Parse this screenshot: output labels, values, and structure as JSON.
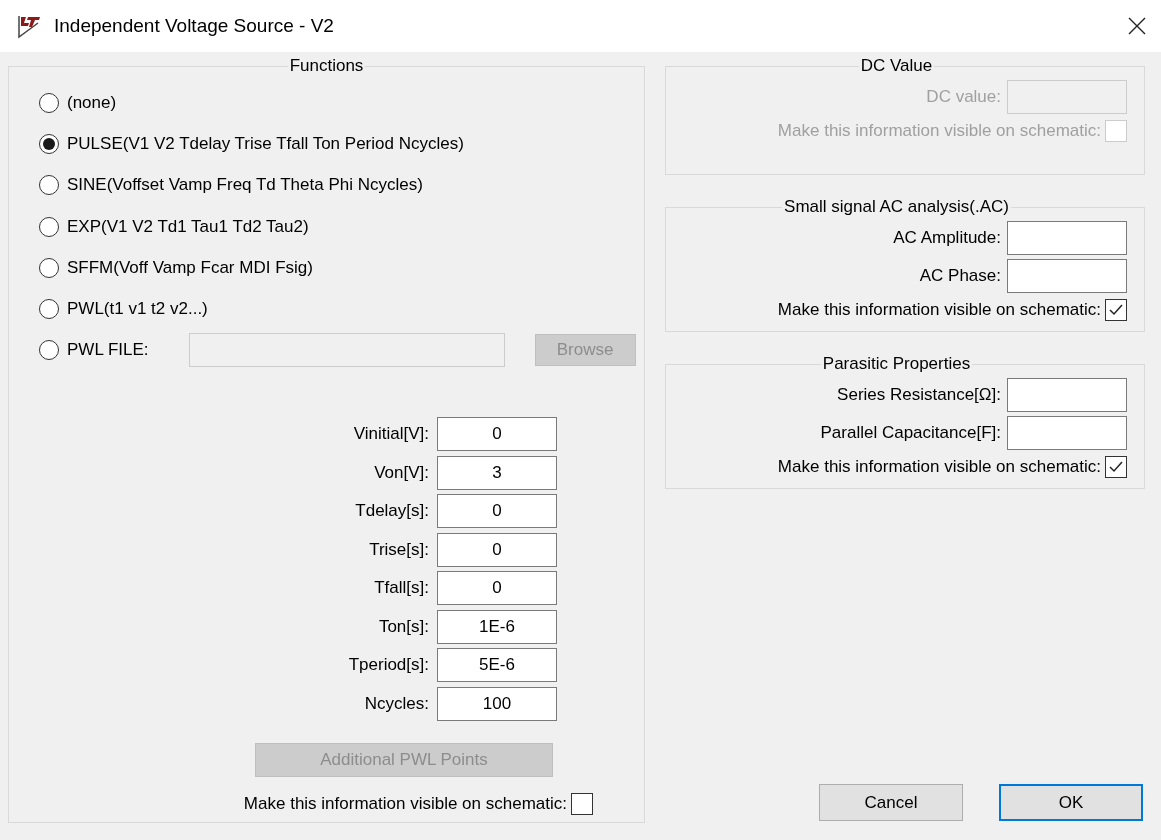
{
  "window": {
    "title": "Independent Voltage Source - V2"
  },
  "functions": {
    "legend": "Functions",
    "options": [
      {
        "label": "(none)",
        "selected": false
      },
      {
        "label": "PULSE(V1 V2 Tdelay Trise Tfall Ton Period Ncycles)",
        "selected": true
      },
      {
        "label": "SINE(Voffset Vamp Freq Td Theta Phi Ncycles)",
        "selected": false
      },
      {
        "label": "EXP(V1 V2 Td1 Tau1 Td2 Tau2)",
        "selected": false
      },
      {
        "label": "SFFM(Voff Vamp Fcar MDI Fsig)",
        "selected": false
      },
      {
        "label": "PWL(t1 v1 t2 v2...)",
        "selected": false
      },
      {
        "label": "PWL FILE:",
        "selected": false,
        "kind": "file"
      }
    ],
    "pwl_file": {
      "disabled": true,
      "browse": {
        "label": "Browse",
        "disabled": true
      }
    },
    "parameters": [
      {
        "label": "Vinitial[V]:",
        "value": "0"
      },
      {
        "label": "Von[V]:",
        "value": "3"
      },
      {
        "label": "Tdelay[s]:",
        "value": "0"
      },
      {
        "label": "Trise[s]:",
        "value": "0"
      },
      {
        "label": "Tfall[s]:",
        "value": "0"
      },
      {
        "label": "Ton[s]:",
        "value": "1E-6"
      },
      {
        "label": "Tperiod[s]:",
        "value": "5E-6"
      },
      {
        "label": "Ncycles:",
        "value": "100"
      }
    ],
    "additional_button": {
      "label": "Additional PWL Points",
      "disabled": true
    },
    "visible": {
      "label": "Make this information visible on schematic:",
      "checked": false
    }
  },
  "groups": [
    {
      "legend": "DC Value",
      "disabled": true,
      "fields": [
        {
          "label": "DC value:"
        }
      ],
      "visible": {
        "label": "Make this information visible on schematic:",
        "checked": false
      }
    },
    {
      "legend": "Small signal AC analysis(.AC)",
      "disabled": false,
      "fields": [
        {
          "label": "AC Amplitude:"
        },
        {
          "label": "AC Phase:"
        }
      ],
      "visible": {
        "label": "Make this information visible on schematic:",
        "checked": true
      }
    },
    {
      "legend": "Parasitic Properties",
      "disabled": false,
      "fields": [
        {
          "label": "Series Resistance[Ω]:"
        },
        {
          "label": "Parallel Capacitance[F]:"
        }
      ],
      "visible": {
        "label": "Make this information visible on schematic:",
        "checked": true
      }
    }
  ],
  "buttons": [
    {
      "label": "Cancel",
      "default": false
    },
    {
      "label": "OK",
      "default": true
    }
  ]
}
